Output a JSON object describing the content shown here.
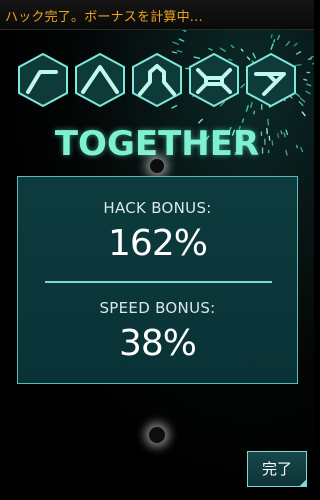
{
  "status_banner": {
    "text": "ハック完了。ボーナスを計算中..."
  },
  "glyph_sequence": {
    "glyphs": [
      "glyph-1-icon",
      "glyph-2-icon",
      "glyph-3-icon",
      "glyph-4-icon",
      "glyph-5-icon"
    ],
    "word": "TOGETHER"
  },
  "bonuses": {
    "hack": {
      "label": "HACK BONUS:",
      "value": "162%"
    },
    "speed": {
      "label": "SPEED BONUS:",
      "value": "38%"
    }
  },
  "done_button": {
    "label": "完了"
  },
  "colors": {
    "banner_text": "#f0a21a",
    "title": "#7ff0d0",
    "panel_bg": "#0c3b3e",
    "panel_border": "#62b9b4",
    "value_text": "#ffffff"
  }
}
